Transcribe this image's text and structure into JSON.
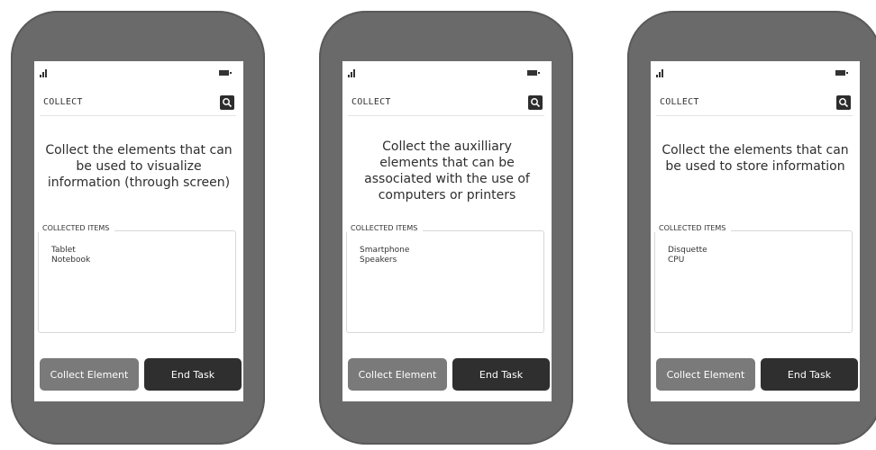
{
  "phones": [
    {
      "header_label": "COLLECT",
      "instruction": "Collect the elements that can be used to visualize information (through screen)",
      "collected_title": "COLLECTED ITEMS",
      "items": [
        "Tablet",
        "Notebook"
      ],
      "collect_button": "Collect Element",
      "end_button": "End Task"
    },
    {
      "header_label": "COLLECT",
      "instruction": "Collect the auxilliary elements that can be associated with the use of computers or printers",
      "collected_title": "COLLECTED ITEMS",
      "items": [
        "Smartphone",
        "Speakers"
      ],
      "collect_button": "Collect Element",
      "end_button": "End Task"
    },
    {
      "header_label": "COLLECT",
      "instruction": "Collect the elements that can be used to store information",
      "collected_title": "COLLECTED ITEMS",
      "items": [
        "Disquette",
        "CPU"
      ],
      "collect_button": "Collect Element",
      "end_button": "End Task"
    }
  ],
  "icons": {
    "signal": "signal-icon",
    "battery": "battery-icon",
    "search": "search-icon"
  },
  "colors": {
    "device_frame": "#6a6a6a",
    "collect_button": "#7a7a7a",
    "end_button": "#2f2f2f"
  }
}
